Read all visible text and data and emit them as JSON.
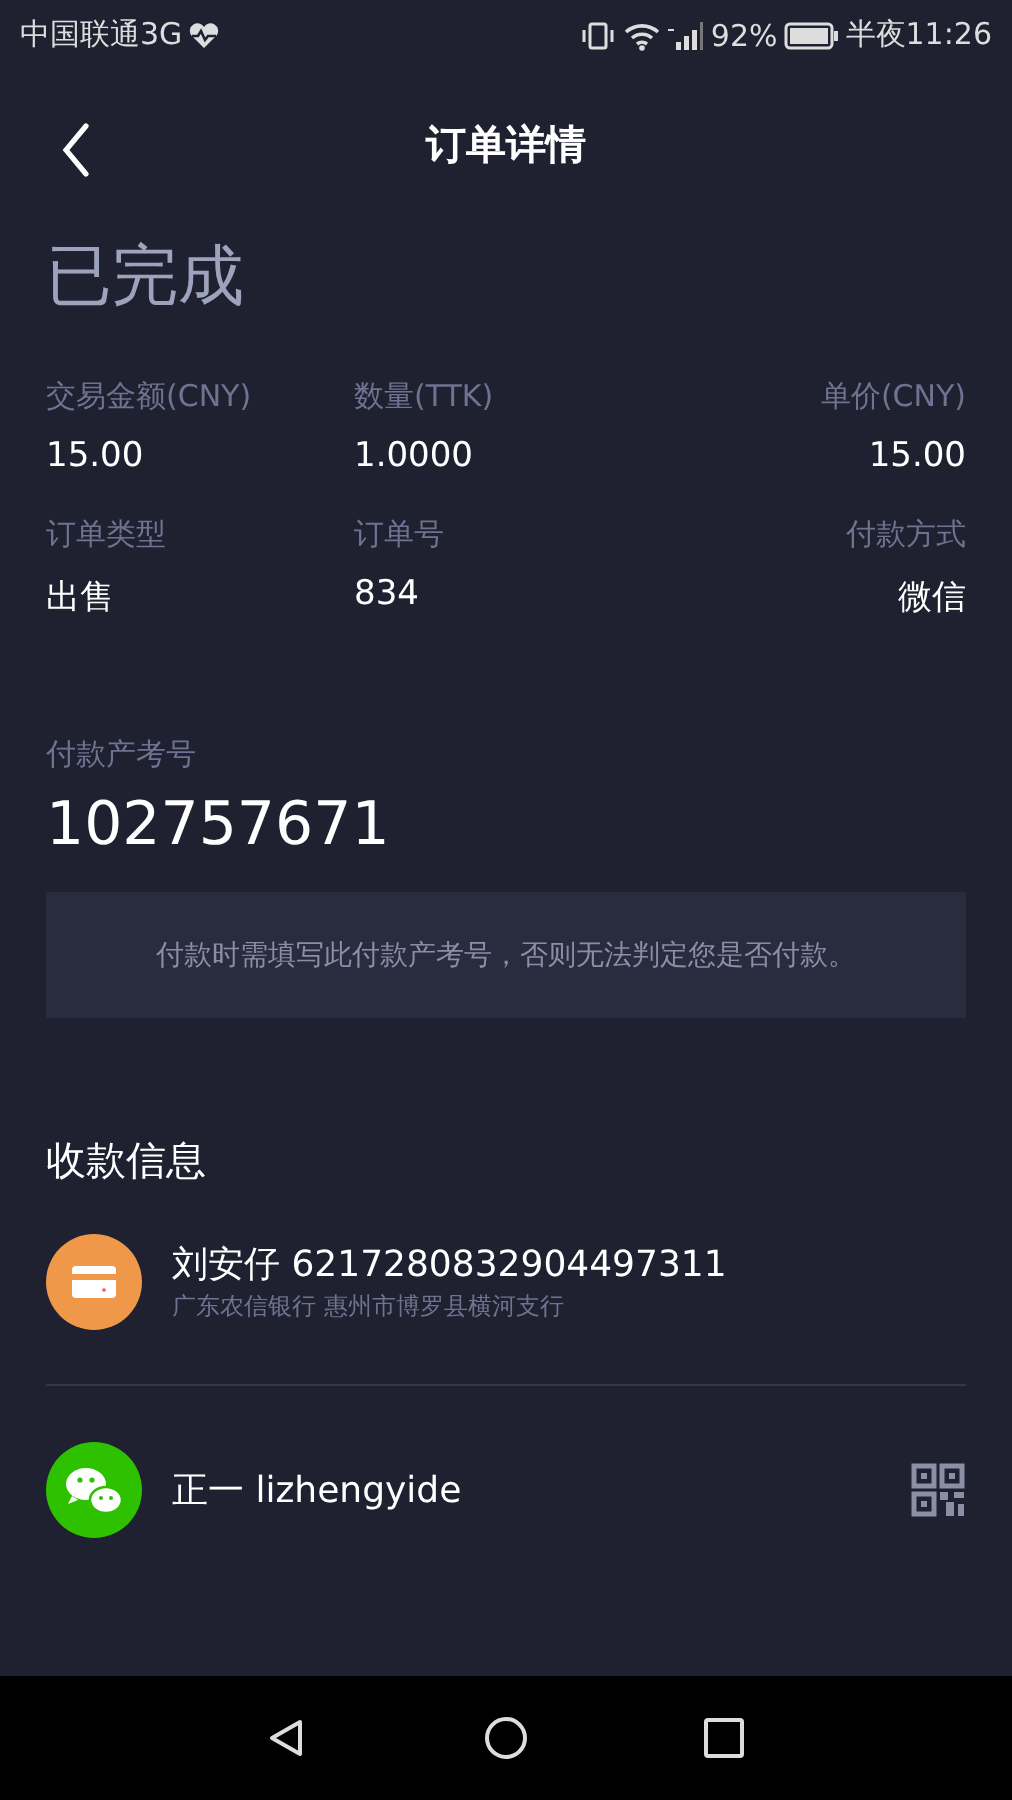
{
  "status_bar": {
    "carrier": "中国联通3G",
    "battery": "92%",
    "time": "半夜11:26"
  },
  "header": {
    "title": "订单详情"
  },
  "order_status": "已完成",
  "fields": [
    {
      "label": "交易金额(CNY)",
      "value": "15.00"
    },
    {
      "label": "数量(TTK)",
      "value": "1.0000"
    },
    {
      "label": "单价(CNY)",
      "value": "15.00"
    },
    {
      "label": "订单类型",
      "value": "出售"
    },
    {
      "label": "订单号",
      "value": "834"
    },
    {
      "label": "付款方式",
      "value": "微信"
    }
  ],
  "reference": {
    "label": "付款产考号",
    "value": "102757671"
  },
  "notice": "付款时需填写此付款产考号，否则无法判定您是否付款。",
  "payment_section": {
    "title": "收款信息",
    "methods": [
      {
        "kind": "bank",
        "name": "刘安仔 6217280832904497311",
        "detail": "广东农信银行 惠州市博罗县横河支行"
      },
      {
        "kind": "wechat",
        "name": "正一 lizhengyide"
      }
    ]
  }
}
